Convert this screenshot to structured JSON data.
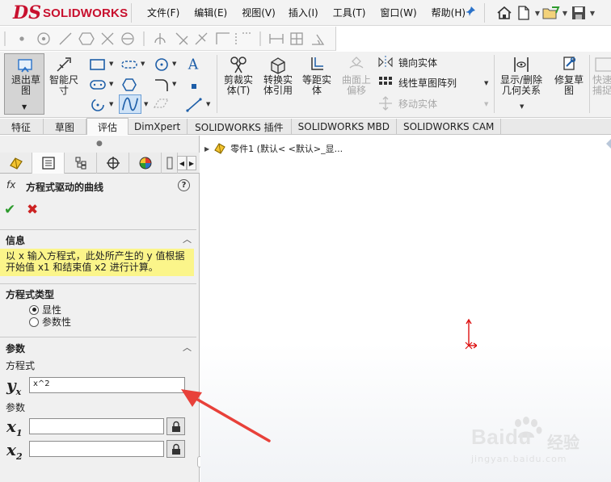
{
  "app": {
    "logo_ds": "DS",
    "logo_text": "SOLIDWORKS"
  },
  "menu": [
    "文件(F)",
    "编辑(E)",
    "视图(V)",
    "插入(I)",
    "工具(T)",
    "窗口(W)",
    "帮助(H)"
  ],
  "ribbon": {
    "exit_sketch": "退出草图",
    "smart_dimension": "智能尺寸",
    "trim": "剪裁实体(T)",
    "convert": "转换实体引用",
    "offset": "等距实体",
    "surface_offset": "曲面上偏移",
    "mirror": "镜向实体",
    "linear_pattern": "线性草图阵列",
    "move": "移动实体",
    "show_delete_relations": "显示/删除几何关系",
    "repair_sketch": "修复草图",
    "quick_snaps": "快速捕捉"
  },
  "tabs": [
    "特征",
    "草图",
    "评估",
    "DimXpert",
    "SOLIDWORKS 插件",
    "SOLIDWORKS MBD",
    "SOLIDWORKS CAM"
  ],
  "active_tab": "草图",
  "property_manager": {
    "fx": "fx",
    "title": "方程式驱动的曲线",
    "help": "?",
    "info": {
      "header": "信息",
      "line1": "以 x 输入方程式，此处所产生的 y 值根据",
      "line2": "开始值 x1 和结束值 x2 进行计算。"
    },
    "equation_type": {
      "header": "方程式类型",
      "options": [
        "显性",
        "参数性"
      ],
      "selected": "显性"
    },
    "parameters": {
      "header": "参数",
      "equation_label": "方程式",
      "yx_value": "x^2",
      "params_label": "参数",
      "x1_value": "",
      "x2_value": ""
    }
  },
  "tree": {
    "item": "零件1  (默认< <默认>_显..."
  },
  "watermark": {
    "brand": "Baidu",
    "cn": "经验",
    "url": "jingyan.baidu.com"
  }
}
